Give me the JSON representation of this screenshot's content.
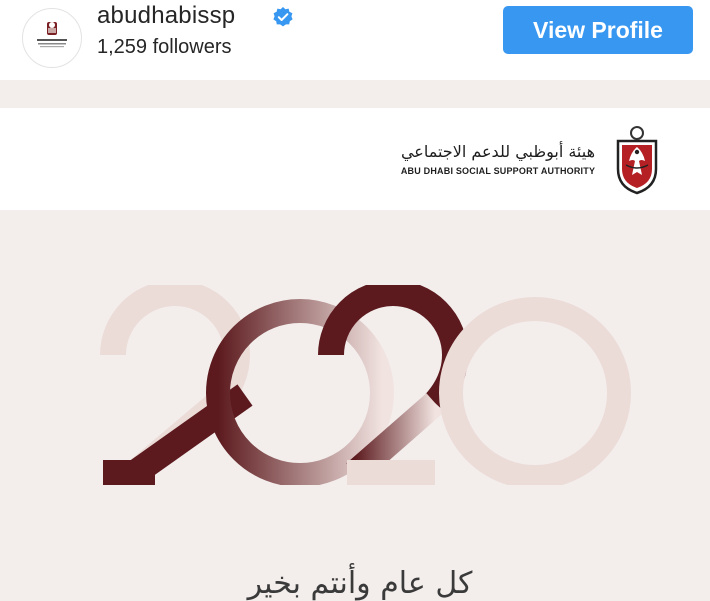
{
  "profile": {
    "username": "abudhabissp",
    "followers": "1,259 followers",
    "view_profile_label": "View Profile",
    "verified": true,
    "avatar_icon": "adssa-logo-icon",
    "accent_color": "#3897f0"
  },
  "post": {
    "org_name_arabic": "هيئة أبوظبي للدعم الاجتماعي",
    "org_name_english": "ABU DHABI SOCIAL SUPPORT AUTHORITY",
    "emblem_icon": "falcon-emblem-icon",
    "year": "2020",
    "year_colors": {
      "dark": "#5c1a1e",
      "light": "#ecdcd8"
    },
    "greeting_arabic": "كل عام وأنتم بخير",
    "background_color": "#f3eeec"
  }
}
